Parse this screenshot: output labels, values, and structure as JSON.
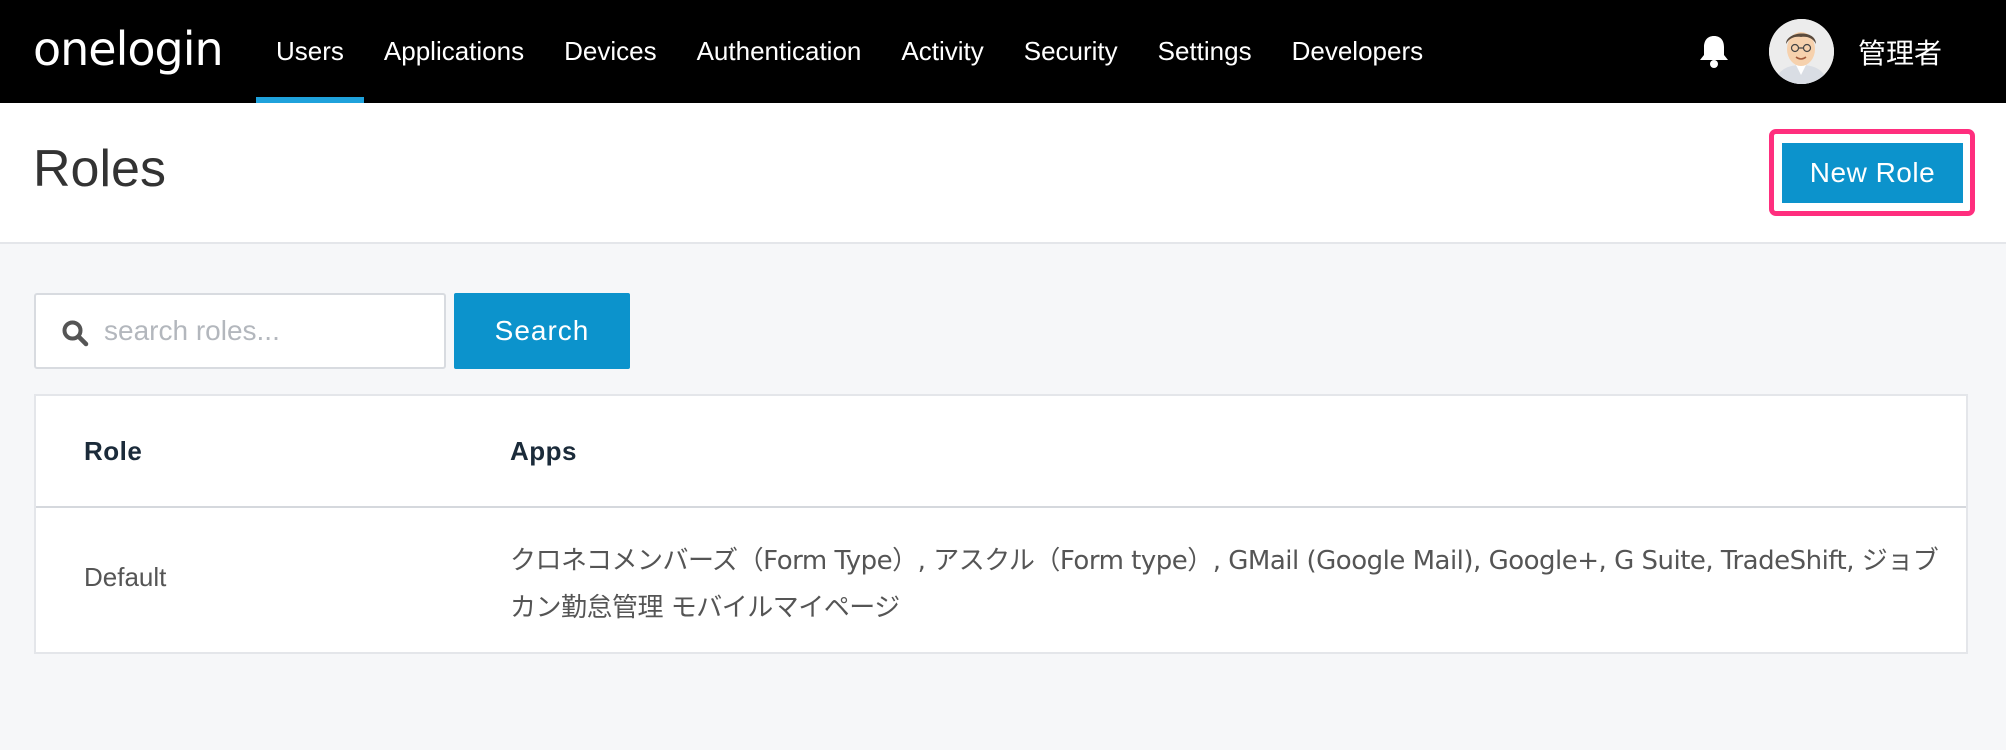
{
  "brand": {
    "logo_text": "onelogin"
  },
  "nav": {
    "items": [
      {
        "label": "Users",
        "active": true
      },
      {
        "label": "Applications"
      },
      {
        "label": "Devices"
      },
      {
        "label": "Authentication"
      },
      {
        "label": "Activity"
      },
      {
        "label": "Security"
      },
      {
        "label": "Settings"
      },
      {
        "label": "Developers"
      }
    ],
    "bell_icon": "bell-icon",
    "user_name": "管理者"
  },
  "header": {
    "title": "Roles",
    "new_role_label": "New Role"
  },
  "search": {
    "placeholder": "search roles...",
    "value": "",
    "button_label": "Search",
    "icon": "search-icon"
  },
  "table": {
    "columns": [
      "Role",
      "Apps"
    ],
    "rows": [
      {
        "role": "Default",
        "apps": "クロネコメンバーズ（Form Type）, アスクル（Form type）, GMail (Google Mail), Google+, G Suite, TradeShift, ジョブカン勤怠管理 モバイルマイページ"
      }
    ]
  },
  "colors": {
    "topbar": "#000000",
    "accent": "#0c93cc",
    "active_tab_underline": "#1fa2dc",
    "highlight_outline": "#ff2e7e"
  }
}
